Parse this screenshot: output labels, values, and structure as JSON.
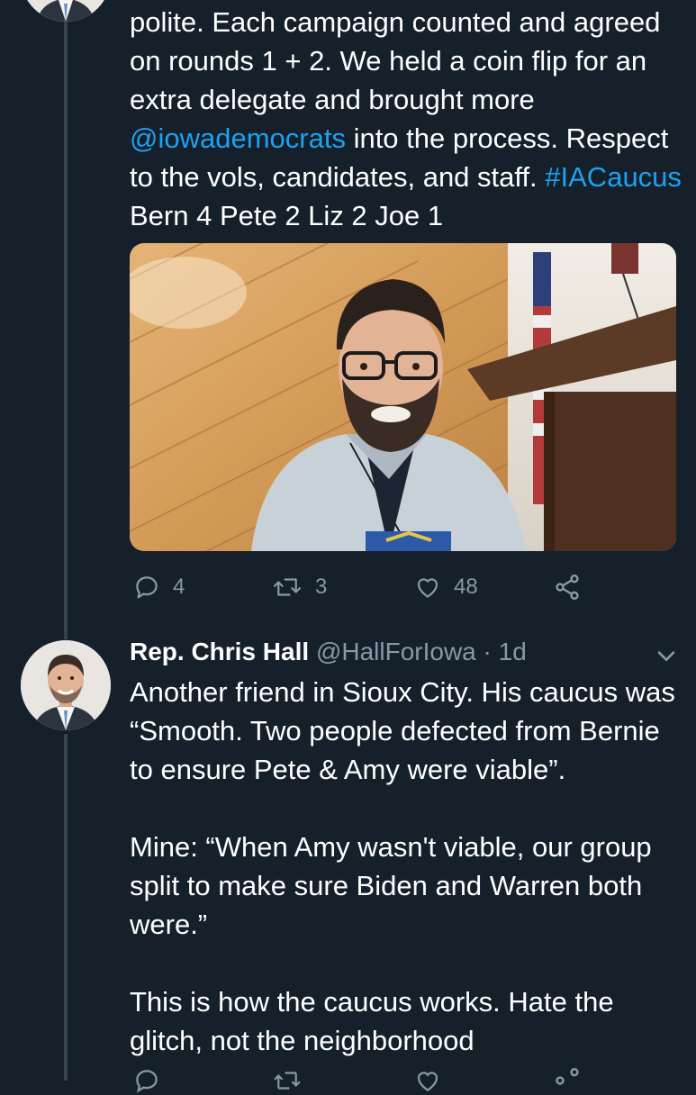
{
  "tweet1": {
    "text_before_mention": "polite. Each campaign counted and agreed on rounds 1 + 2. We held a coin flip for an extra delegate and brought more ",
    "mention": "@iowademocrats",
    "text_after_mention": " into the process. Respect to the vols, candidates, and staff. ",
    "hashtag": "#IACaucus",
    "text_after_hashtag": " Bern 4 Pete 2 Liz 2 Joe 1",
    "actions": {
      "reply_count": "4",
      "retweet_count": "3",
      "like_count": "48"
    }
  },
  "tweet2": {
    "name": "Rep. Chris Hall",
    "handle": "@HallForIowa",
    "separator": " · ",
    "time": "1d",
    "text": "Another friend in Sioux City. His caucus was “Smooth. Two people defected from Bernie to ensure Pete & Amy were viable”.\n\nMine: “When Amy wasn't viable, our group split to make sure Biden and Warren both were.”\n\nThis is how the caucus works. Hate the glitch, not the neighborhood"
  },
  "icons": {
    "reply": "reply-icon",
    "retweet": "retweet-icon",
    "like": "heart-icon",
    "share": "share-icon",
    "caret": "chevron-down-icon"
  },
  "colors": {
    "background": "#15202b",
    "text": "#ffffff",
    "secondary": "#8899a6",
    "link": "#1da1f2",
    "thread_line": "#38444d"
  }
}
